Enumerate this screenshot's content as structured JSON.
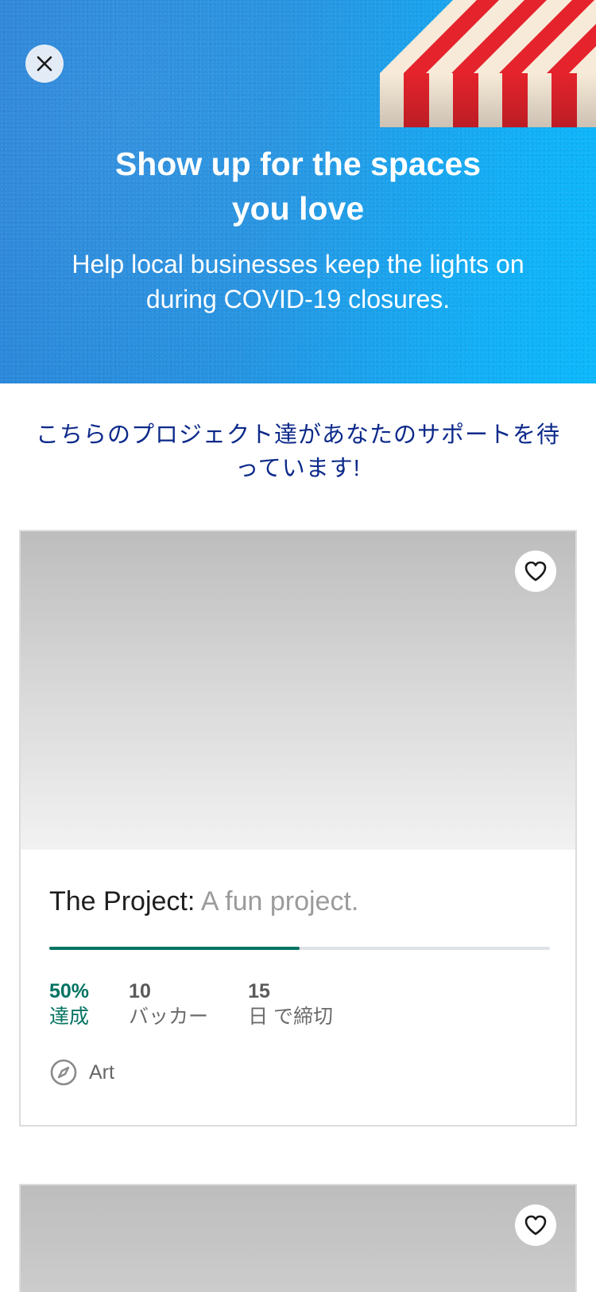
{
  "banner": {
    "close_label": "×",
    "title": "Show up for the spaces you love",
    "subtitle": "Help local businesses keep the lights on during COVID-19 closures."
  },
  "section": {
    "heading": "こちらのプロジェクト達があなたのサポートを待っています!"
  },
  "projects": [
    {
      "name": "The Project:",
      "blurb": " A fun project.",
      "percent_funded": 50,
      "stats": {
        "funded_value": "50%",
        "funded_label": "達成",
        "backers_value": "10",
        "backers_label": "バッカー",
        "days_value": "15",
        "days_label": "日 で締切"
      },
      "category": "Art"
    },
    {
      "name": "",
      "blurb": ""
    }
  ],
  "colors": {
    "accent_green": "#037362",
    "heading_navy": "#0d2a8a",
    "banner_blue": "#2492e0"
  },
  "icons": [
    "close-icon",
    "heart-icon",
    "compass-icon",
    "awning-illustration"
  ]
}
